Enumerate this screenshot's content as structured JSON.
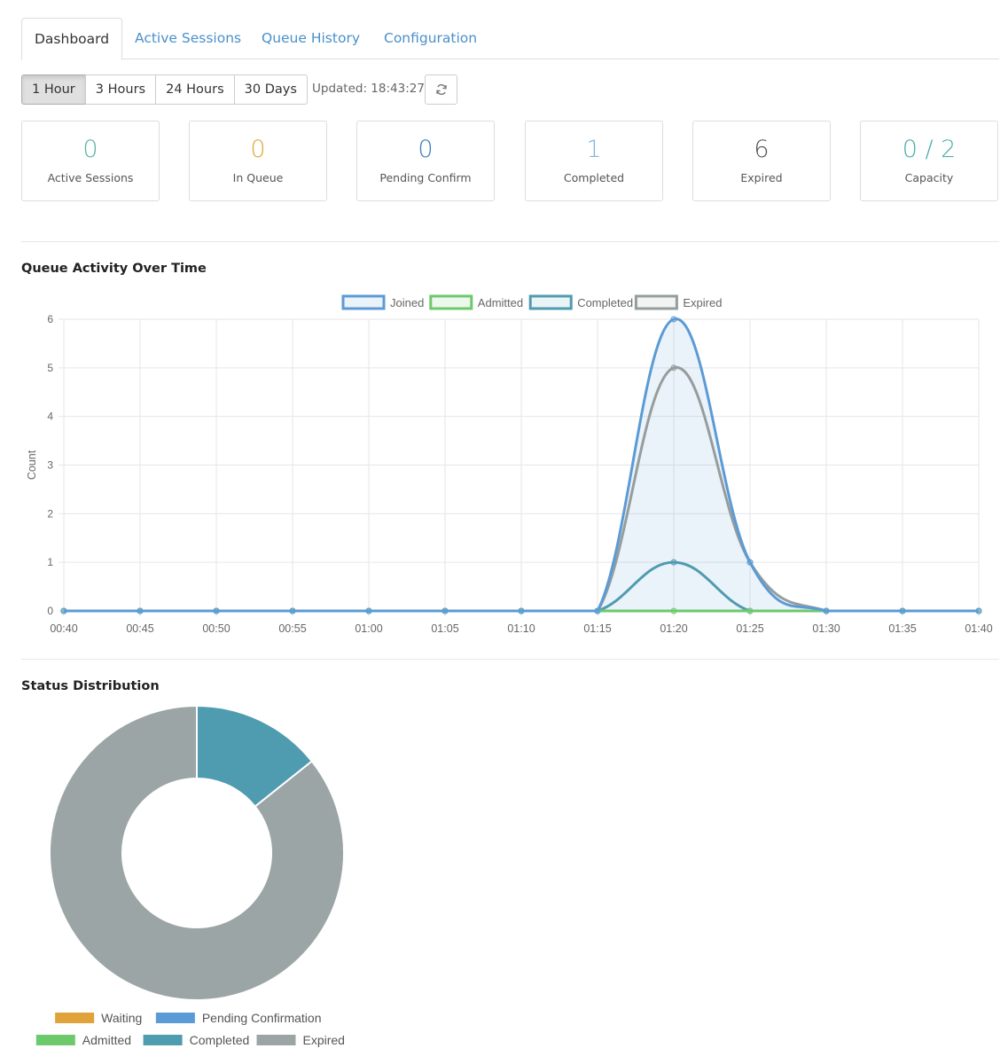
{
  "tabs": [
    {
      "label": "Dashboard",
      "active": true
    },
    {
      "label": "Active Sessions",
      "active": false
    },
    {
      "label": "Queue History",
      "active": false
    },
    {
      "label": "Configuration",
      "active": false
    }
  ],
  "range_buttons": [
    {
      "label": "1 Hour",
      "active": true
    },
    {
      "label": "3 Hours",
      "active": false
    },
    {
      "label": "24 Hours",
      "active": false
    },
    {
      "label": "30 Days",
      "active": false
    }
  ],
  "updated_text": "Updated: 18:43:27",
  "refresh_icon": "refresh-icon",
  "stats": [
    {
      "value": "0",
      "label": "Active Sessions",
      "color": "#5cb3a6"
    },
    {
      "value": "0",
      "label": "In Queue",
      "color": "#e0ab3a"
    },
    {
      "value": "0",
      "label": "Pending Confirm",
      "color": "#3e7cc2"
    },
    {
      "value": "1",
      "label": "Completed",
      "color": "#7eb3e0"
    },
    {
      "value": "6",
      "label": "Expired",
      "color": "#555555"
    },
    {
      "value": "0 / 2",
      "label": "Capacity",
      "color": "#4ab0a8"
    }
  ],
  "sections": {
    "activity_title": "Queue Activity Over Time",
    "status_title": "Status Distribution"
  },
  "chart_data": [
    {
      "type": "line",
      "title": "Queue Activity Over Time",
      "ylabel": "Count",
      "xlabel": "",
      "ylim": [
        0,
        6
      ],
      "yticks": [
        "0",
        "1",
        "2",
        "3",
        "4",
        "5",
        "6"
      ],
      "x": [
        "00:40",
        "00:45",
        "00:50",
        "00:55",
        "01:00",
        "01:05",
        "01:10",
        "01:15",
        "01:20",
        "01:25",
        "01:30",
        "01:35",
        "01:40"
      ],
      "grid": true,
      "legend": "top-center",
      "series": [
        {
          "name": "Joined",
          "color": "#5b9bd5",
          "fill": true,
          "values": [
            0,
            0,
            0,
            0,
            0,
            0,
            0,
            0,
            6,
            1,
            0,
            0,
            0
          ]
        },
        {
          "name": "Admitted",
          "color": "#6cc96c",
          "fill": false,
          "values": [
            0,
            0,
            0,
            0,
            0,
            0,
            0,
            0,
            0,
            0,
            0,
            0,
            0
          ]
        },
        {
          "name": "Completed",
          "color": "#4f9bb0",
          "fill": false,
          "values": [
            0,
            0,
            0,
            0,
            0,
            0,
            0,
            0,
            1,
            0,
            0,
            0,
            0
          ]
        },
        {
          "name": "Expired",
          "color": "#959d9d",
          "fill": false,
          "values": [
            0,
            0,
            0,
            0,
            0,
            0,
            0,
            0,
            5,
            1,
            0,
            0,
            0
          ]
        }
      ]
    },
    {
      "type": "pie",
      "variant": "donut",
      "title": "Status Distribution",
      "legend": "bottom",
      "categories": [
        "Waiting",
        "Pending Confirmation",
        "Admitted",
        "Completed",
        "Expired"
      ],
      "values": [
        0,
        0,
        0,
        1,
        6
      ],
      "colors": [
        "#e0a33a",
        "#5b9bd5",
        "#6cc96c",
        "#4f9bb0",
        "#9ba5a5"
      ]
    }
  ]
}
